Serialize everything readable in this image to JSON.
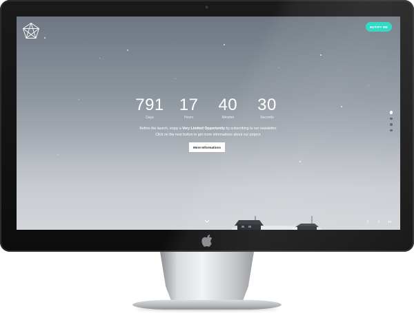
{
  "header": {
    "notify_label": "NOTIFY ME"
  },
  "countdown": {
    "units": [
      {
        "value": "791",
        "label": "Days"
      },
      {
        "value": "17",
        "label": "Hours"
      },
      {
        "value": "40",
        "label": "Minutes"
      },
      {
        "value": "30",
        "label": "Seconds"
      }
    ]
  },
  "tagline": {
    "line1_pre": "Before the launch, enjoy a ",
    "line1_bold": "Very Limited Opportunity",
    "line1_post": " by subscribing to our newsletter.",
    "line2": "Click on the next button to get more informations about our project."
  },
  "cta": {
    "more_label": "More Informations"
  },
  "nav_dots": {
    "count": 4,
    "active_index": 0
  },
  "social": {
    "icons": [
      "facebook-icon",
      "twitter-icon",
      "linkedin-icon"
    ],
    "glyphs": [
      "f",
      "t",
      "in"
    ]
  },
  "colors": {
    "accent": "#1fd6c0"
  }
}
